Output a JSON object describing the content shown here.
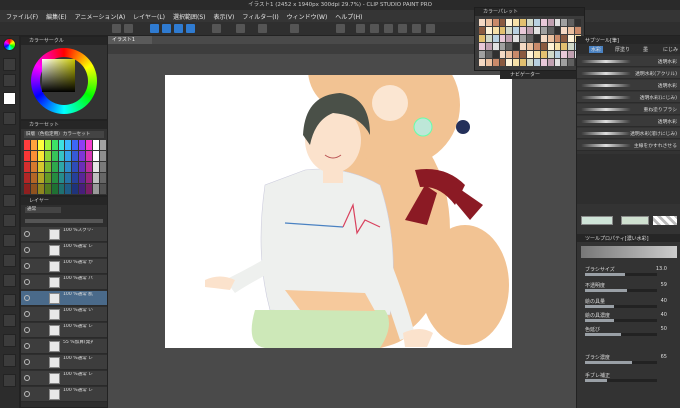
{
  "titlebar": {
    "title": "イラスト1 (2452 x 1940px 300dpi 29.7%) - CLIP STUDIO PAINT PRO"
  },
  "menu": [
    "ファイル(F)",
    "編集(E)",
    "アニメーション(A)",
    "レイヤー(L)",
    "選択範囲(S)",
    "表示(V)",
    "フィルター(I)",
    "ウィンドウ(W)",
    "ヘルプ(H)"
  ],
  "panels": {
    "color_wheel": "カラーサークル",
    "color_set": "カラーセット",
    "color_set_name": "旧版（色指定用）カラーセット",
    "layer": "レイヤー",
    "palette": "カラーパレット",
    "navigator": "ナビゲーター",
    "subtool": "サブツール[筆]",
    "tool_property": "ツールプロパティ[濃い水彩]"
  },
  "document": {
    "tab": "イラスト1"
  },
  "layers": [
    {
      "name": "100 %スクリーン レイヤー 10"
    },
    {
      "name": "100 %通常 レイヤー 11"
    },
    {
      "name": "100 %通常 かみのけ"
    },
    {
      "name": "100 %通常 パーカー"
    },
    {
      "name": "100 %通常 肌"
    },
    {
      "name": "100 %通常 いれかしん"
    },
    {
      "name": "100 %通常 レイヤー 14"
    },
    {
      "name": "55 %加算(発光) レイヤー 12"
    },
    {
      "name": "100 %通常 レイヤー 8"
    },
    {
      "name": "100 %通常 レイヤー 7"
    },
    {
      "name": "100 %通常 レイヤー 6"
    }
  ],
  "layer_mode": "通常",
  "brushes": [
    {
      "label": "水彩"
    },
    {
      "label": "厚塗り"
    },
    {
      "label": "墨"
    },
    {
      "label": "にじみ"
    },
    {
      "label": "透明水彩"
    },
    {
      "label": "透明水彩(アクリル)"
    },
    {
      "label": "透明水彩"
    },
    {
      "label": "透明水彩(にじみ)"
    },
    {
      "label": "重ね塗りブラシ"
    },
    {
      "label": "透明水彩"
    },
    {
      "label": "透明水彩(溶けにじみ)"
    },
    {
      "label": "主線をかすれさせる"
    }
  ],
  "properties": [
    {
      "label": "ブラシサイズ",
      "value": "13.0",
      "level": 0.55
    },
    {
      "label": "不透明度",
      "value": "59",
      "level": 0.59
    },
    {
      "label": "絵の具量",
      "value": "40",
      "level": 0.4
    },
    {
      "label": "絵の具濃度",
      "value": "40",
      "level": 0.4
    },
    {
      "label": "色延び",
      "value": "50",
      "level": 0.5
    },
    {
      "label": "ブラシ濃度",
      "value": "65",
      "level": 0.65
    },
    {
      "label": "手ブレ補正",
      "value": "",
      "level": 0.3
    }
  ],
  "colors": {
    "accent": "#4a82c2",
    "paper": "#ffffff",
    "bear": "#f2c393",
    "scarf": "#8b1a24",
    "hoodie": "#eef0ee",
    "shorts": "#cde8b8"
  }
}
